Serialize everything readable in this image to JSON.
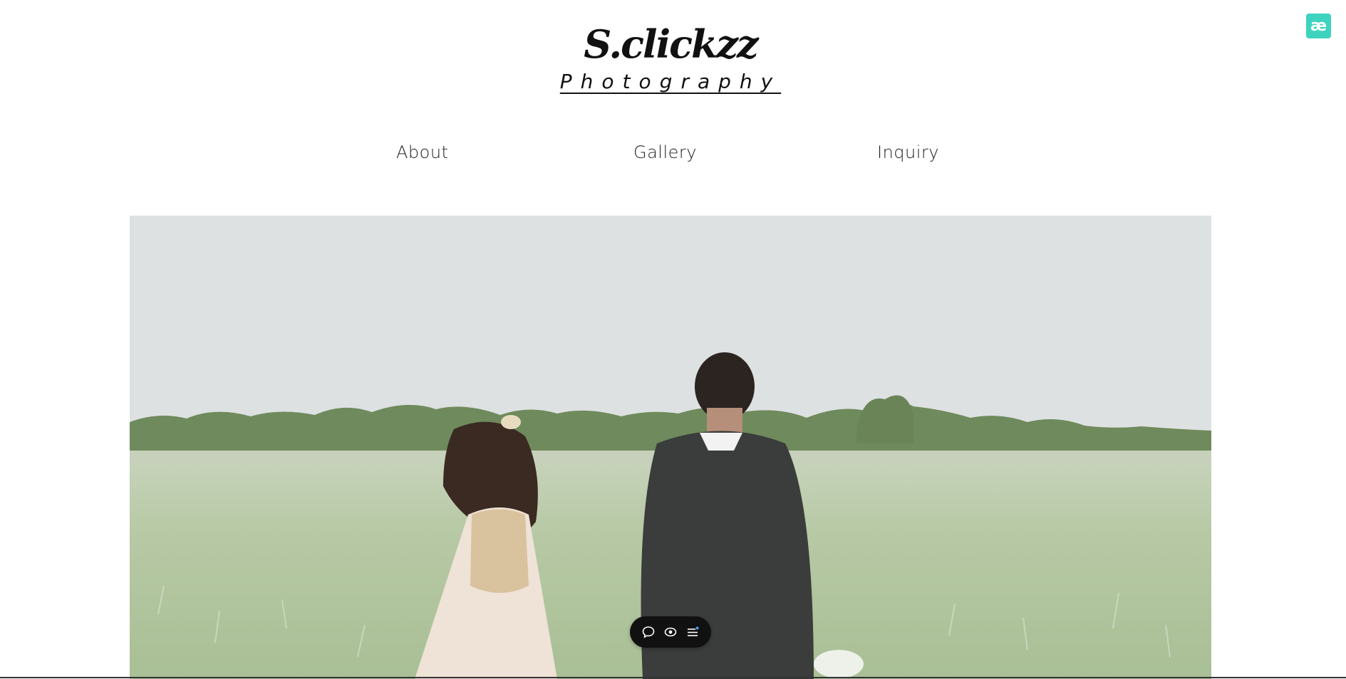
{
  "brand": {
    "title": "S.clickzz",
    "subtitle": "Photography"
  },
  "nav": {
    "items": [
      {
        "label": "About"
      },
      {
        "label": "Gallery"
      },
      {
        "label": "Inquiry"
      }
    ]
  },
  "corner_badge": {
    "glyph": "æ",
    "icon": "ae-app-icon",
    "color": "#3ed3bf"
  },
  "hero": {
    "image": "wedding-couple-walking-in-field-photo"
  },
  "floating_toolbar": {
    "icons": [
      "comment-icon",
      "eye-icon",
      "menu-list-icon"
    ]
  }
}
